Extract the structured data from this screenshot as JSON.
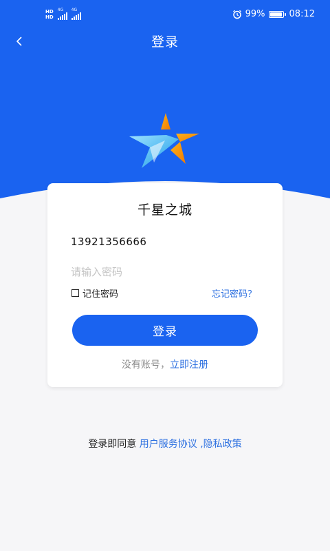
{
  "status_bar": {
    "hd_top": "HD",
    "hd_bottom": "HD",
    "net1": "4G",
    "net2": "4G",
    "battery_percent": "99%",
    "battery_level": 0.99,
    "time": "08:12",
    "icons": [
      "alarm-icon",
      "battery-icon",
      "signal-icon"
    ]
  },
  "nav": {
    "title": "登录",
    "back_icon": "chevron-left-icon"
  },
  "logo": {
    "icon": "star-logo-icon"
  },
  "card": {
    "app_name": "千星之城",
    "phone_value": "13921356666",
    "password_placeholder": "请输入密码",
    "remember_label": "记住密码",
    "forgot_label": "忘记密码？",
    "login_label": "登录",
    "no_account_text": "没有账号，",
    "register_label": "立即注册"
  },
  "agreement": {
    "prefix": "登录即同意",
    "terms_label": "用户服务协议",
    "separator": " ,",
    "privacy_label": "隐私政策"
  },
  "colors": {
    "primary": "#1a63f0",
    "link": "#2b6fe0",
    "background": "#f6f6f8"
  }
}
